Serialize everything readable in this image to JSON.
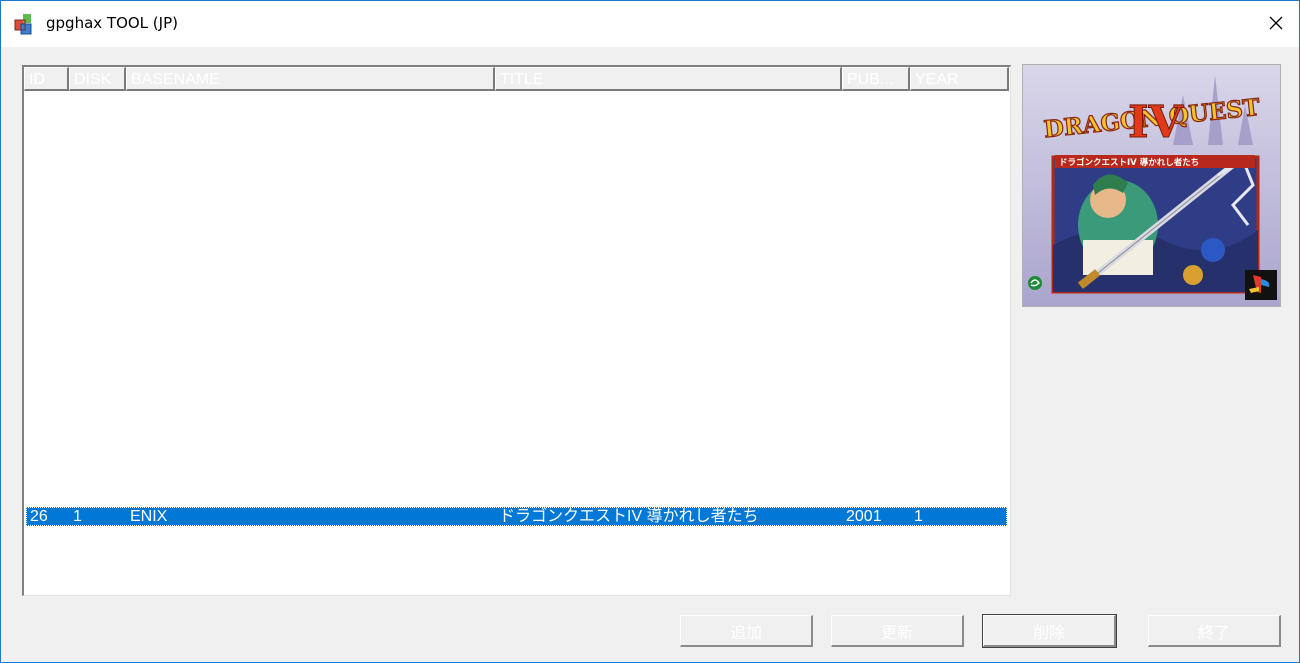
{
  "window": {
    "title": "gpghax TOOL (JP)"
  },
  "table": {
    "columns": [
      "ID",
      "DISK",
      "BASENAME",
      "TITLE",
      "PUB...",
      "YEAR"
    ],
    "rows": [
      {
        "id": "26",
        "disk": "1",
        "basename": "ENIX",
        "title": "ドラゴンクエストIV 導かれし者たち",
        "pub": "2001",
        "year": "1",
        "selected": true
      }
    ]
  },
  "cover": {
    "logo_text": "DRAGON QUEST",
    "numeral": "IV",
    "subtitle": "ドラゴンクエストIV 導かれし者たち",
    "colors": {
      "background": "#2f3d86",
      "logo": "#d44a1a",
      "sky": "#c9c7e3"
    }
  },
  "buttons": {
    "add": "追加",
    "update": "更新",
    "delete": "削除",
    "quit": "終了"
  },
  "colors": {
    "selection": "#0078d7",
    "window_border": "#1979ca",
    "face": "#f0f0f0"
  }
}
